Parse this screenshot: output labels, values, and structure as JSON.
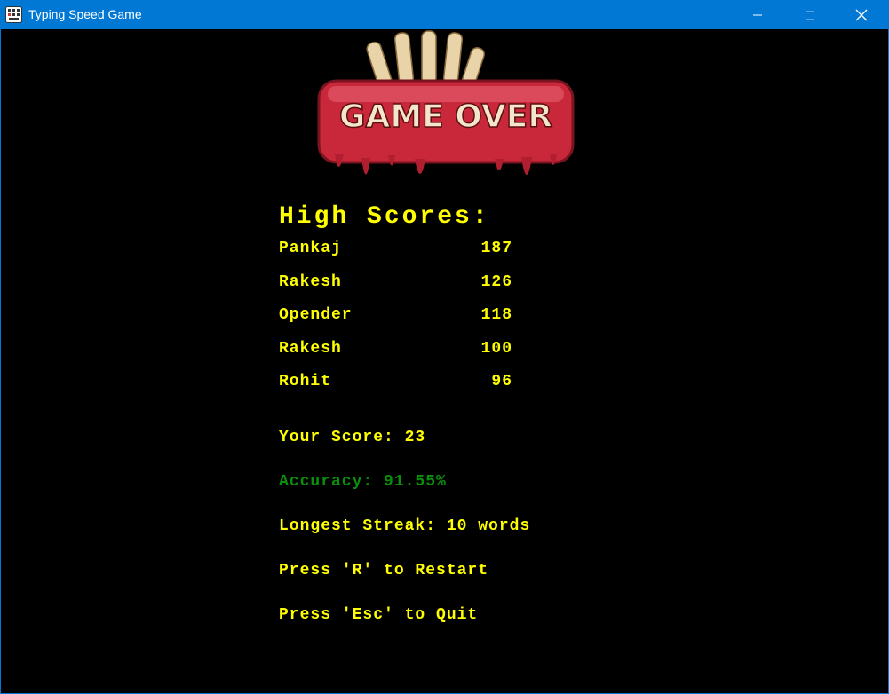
{
  "window": {
    "title": "Typing Speed Game",
    "app_icon": "keyboard-icon"
  },
  "game_over": {
    "banner_text": "GAME OVER",
    "high_scores_title": "High Scores:",
    "high_scores": [
      {
        "name": "Pankaj",
        "score": "187"
      },
      {
        "name": "Rakesh",
        "score": "126"
      },
      {
        "name": "Opender",
        "score": "118"
      },
      {
        "name": "Rakesh",
        "score": "100"
      },
      {
        "name": "Rohit",
        "score": "96"
      }
    ],
    "your_score": "Your Score: 23",
    "accuracy": "Accuracy: 91.55%",
    "longest_streak": "Longest Streak: 10 words",
    "restart_hint": "Press 'R' to Restart",
    "quit_hint": "Press 'Esc' to Quit"
  },
  "colors": {
    "titlebar": "#0078d4",
    "background": "#000000",
    "text_yellow": "#ffff00",
    "accuracy_green": "#0a8f0a",
    "banner_red": "#c8283a"
  }
}
